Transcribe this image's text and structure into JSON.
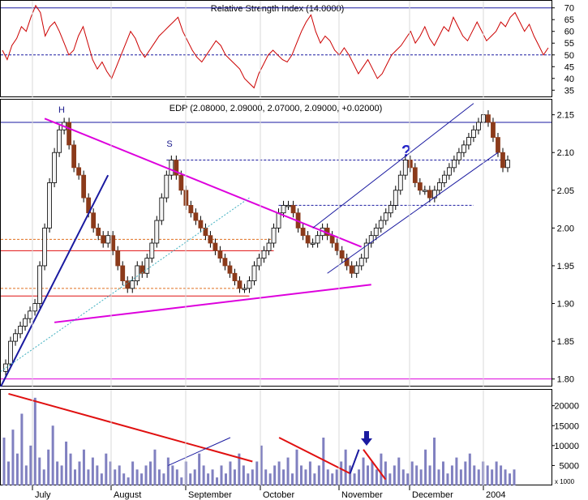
{
  "colors": {
    "bull": "#f4f4f4",
    "bear": "#8b3a1a",
    "rsi": "#cc0000",
    "volume": "#8080c0",
    "magenta": "#dd00dd",
    "blue": "#1a1aa0",
    "red_line": "#e01010",
    "grid": "#d9d9d9",
    "orange_dash": "#e07020"
  },
  "rsi_panel": {
    "title": "Relative Strength Index (14.0000)",
    "ticks": [
      "70",
      "65",
      "60",
      "55",
      "50",
      "45",
      "40",
      "35"
    ]
  },
  "price_panel": {
    "title": "EDP (2.08000, 2.09000, 2.07000, 2.09000, +0.02000)",
    "ticks": [
      "2.15",
      "2.10",
      "2.05",
      "2.00",
      "1.95",
      "1.90",
      "1.85",
      "1.80"
    ]
  },
  "volume_panel": {
    "ticks": [
      "20000",
      "15000",
      "10000",
      "5000"
    ],
    "scale_label": "x 1000"
  },
  "annotations": {
    "head_label": "H",
    "shoulder_label": "S",
    "question_mark": "?",
    "arrow": "down-arrow-icon"
  },
  "months": [
    "July",
    "August",
    "September",
    "October",
    "November",
    "December",
    "2004"
  ],
  "chart_data": [
    {
      "type": "line",
      "title": "Relative Strength Index (14.0000)",
      "ylim": [
        32,
        73
      ],
      "reference_lines": [
        70,
        50
      ],
      "series": [
        {
          "name": "Relative Strength Index",
          "values": [
            52,
            48,
            54,
            57,
            62,
            60,
            66,
            71,
            68,
            58,
            62,
            64,
            60,
            55,
            50,
            52,
            58,
            62,
            55,
            48,
            44,
            47,
            43,
            40,
            45,
            50,
            55,
            60,
            57,
            52,
            49,
            52,
            55,
            58,
            60,
            62,
            64,
            66,
            60,
            56,
            52,
            49,
            47,
            50,
            53,
            56,
            54,
            50,
            48,
            46,
            44,
            40,
            38,
            36,
            42,
            46,
            50,
            52,
            50,
            48,
            47,
            50,
            55,
            60,
            64,
            67,
            60,
            55,
            58,
            56,
            52,
            50,
            53,
            50,
            46,
            42,
            45,
            48,
            44,
            40,
            42,
            46,
            50,
            52,
            54,
            57,
            60,
            55,
            58,
            62,
            57,
            54,
            58,
            62,
            60,
            66,
            62,
            58,
            56,
            60,
            64,
            60,
            56,
            58,
            60,
            64,
            62,
            66,
            68,
            64,
            60,
            63,
            58,
            54,
            50,
            53
          ]
        }
      ]
    },
    {
      "type": "line",
      "title": "EDP (2.08000, 2.09000, 2.07000, 2.09000, +0.02000)",
      "ylim": [
        1.79,
        2.17
      ],
      "reference_lines": [
        2.14,
        1.8,
        2.09,
        2.03
      ],
      "series": [
        {
          "name": "EDP",
          "values": [
            1.82,
            1.85,
            1.86,
            1.87,
            1.88,
            1.89,
            1.9,
            1.95,
            2.0,
            2.06,
            2.1,
            2.13,
            2.14,
            2.11,
            2.08,
            2.07,
            2.04,
            2.02,
            2.0,
            1.99,
            1.98,
            1.99,
            1.97,
            1.95,
            1.93,
            1.92,
            1.93,
            1.95,
            1.94,
            1.96,
            1.98,
            2.01,
            2.04,
            2.07,
            2.09,
            2.07,
            2.05,
            2.03,
            2.02,
            2.01,
            2.0,
            1.99,
            1.98,
            1.97,
            1.96,
            1.95,
            1.94,
            1.93,
            1.92,
            1.92,
            1.93,
            1.95,
            1.96,
            1.97,
            1.98,
            2.0,
            2.02,
            2.03,
            2.03,
            2.02,
            2.0,
            1.99,
            1.98,
            1.98,
            1.99,
            2.0,
            1.99,
            1.98,
            1.97,
            1.96,
            1.95,
            1.94,
            1.95,
            1.96,
            1.98,
            1.99,
            2.0,
            2.01,
            2.02,
            2.03,
            2.05,
            2.07,
            2.09,
            2.08,
            2.06,
            2.05,
            2.05,
            2.04,
            2.05,
            2.06,
            2.07,
            2.08,
            2.09,
            2.1,
            2.11,
            2.12,
            2.13,
            2.14,
            2.15,
            2.14,
            2.12,
            2.1,
            2.08,
            2.09
          ]
        }
      ]
    },
    {
      "type": "bar",
      "title": "",
      "ylim": [
        0,
        24000
      ],
      "series": [
        {
          "name": "",
          "values": [
            12000,
            6000,
            14000,
            8000,
            18000,
            5000,
            10000,
            22000,
            7000,
            4000,
            9000,
            15000,
            6000,
            5000,
            11000,
            8000,
            4000,
            6000,
            9000,
            4000,
            7000,
            5000,
            3000,
            8000,
            6000,
            4000,
            5000,
            3000,
            2000,
            6000,
            4000,
            3000,
            5000,
            6000,
            9000,
            4000,
            3000,
            7000,
            5000,
            4000,
            2000,
            6000,
            3000,
            4000,
            8000,
            5000,
            3000,
            4000,
            2000,
            5000,
            3000,
            6000,
            4000,
            8000,
            5000,
            3000,
            4000,
            6000,
            10000,
            4000,
            3000,
            5000,
            6000,
            4000,
            7000,
            3000,
            9000,
            5000,
            4000,
            6000,
            3000,
            5000,
            12000,
            4000,
            3000,
            4000,
            6000,
            9000,
            5000,
            3000,
            4000,
            7000,
            5000,
            6000,
            4000,
            8000,
            6000,
            3000,
            5000,
            7000,
            4000,
            3000,
            6000,
            5000,
            4000,
            9000,
            5000,
            12000,
            4000,
            6000,
            3000,
            5000,
            7000,
            4000,
            6000,
            8000,
            5000,
            4000,
            6000,
            5000,
            4000,
            6000,
            5000,
            4000,
            3000,
            4000
          ]
        }
      ]
    }
  ]
}
